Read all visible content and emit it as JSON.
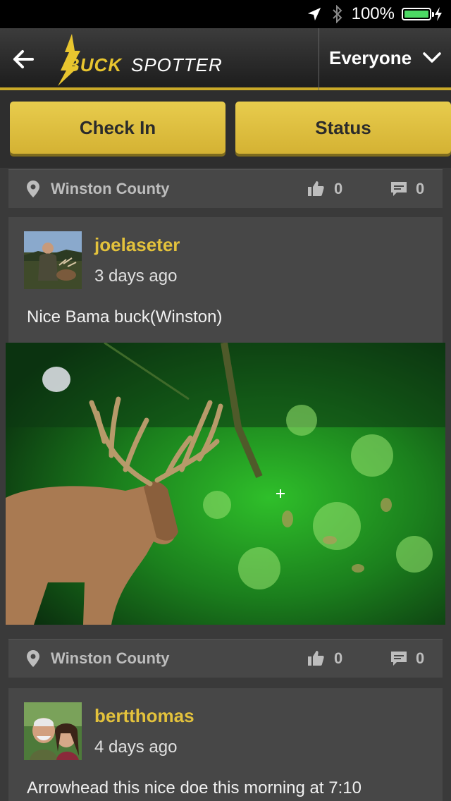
{
  "status_bar": {
    "battery_percent": "100%",
    "icons": [
      "location-arrow-icon",
      "bluetooth-icon",
      "battery-icon",
      "charging-bolt-icon"
    ]
  },
  "header": {
    "app_name": "BUCKSPOTTER",
    "filter_label": "Everyone"
  },
  "actions": {
    "check_in_label": "Check In",
    "status_label": "Status"
  },
  "feed": {
    "top_meta": {
      "location": "Winston County",
      "likes": "0",
      "comments": "0"
    },
    "posts": [
      {
        "username": "joelaseter",
        "time": "3 days ago",
        "text": "Nice Bama buck(Winston)",
        "location": "Winston County",
        "likes": "0",
        "comments": "0"
      },
      {
        "username": "bertthomas",
        "time": "4 days ago",
        "text": "Arrowhead this nice doe this morning at 7:10"
      }
    ]
  },
  "colors": {
    "accent": "#e3c23c",
    "button": "#dcbc3e",
    "card": "#474747",
    "background": "#3a3a3a"
  }
}
